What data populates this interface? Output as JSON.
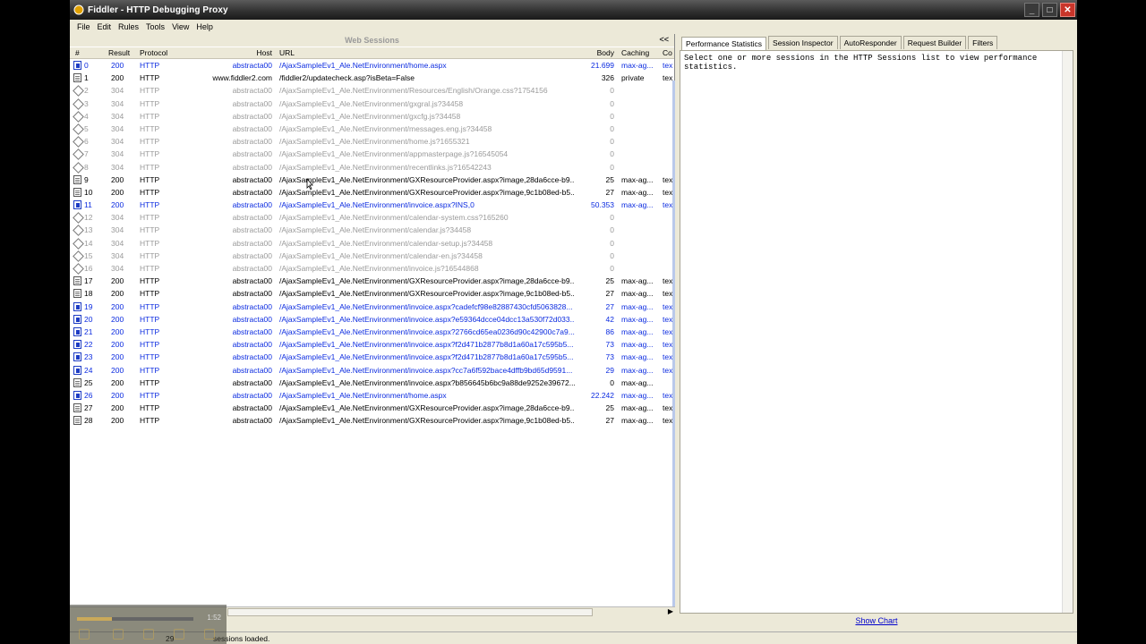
{
  "window": {
    "title": "Fiddler - HTTP Debugging Proxy"
  },
  "menu": [
    "File",
    "Edit",
    "Rules",
    "Tools",
    "View",
    "Help"
  ],
  "sessions_panel": {
    "title": "Web Sessions",
    "collapse_label": "<<",
    "columns": {
      "num": "#",
      "result": "Result",
      "protocol": "Protocol",
      "host": "Host",
      "url": "URL",
      "body": "Body",
      "caching": "Caching",
      "content_type": "Co"
    },
    "rows": [
      {
        "num": "0",
        "result": "200",
        "protocol": "HTTP",
        "host": "abstracta00",
        "url": "/AjaxSampleEv1_Ale.NetEnvironment/home.aspx",
        "body": "21.699",
        "caching": "max-ag...",
        "ct": "tex",
        "style": "blue",
        "icon": "blue"
      },
      {
        "num": "1",
        "result": "200",
        "protocol": "HTTP",
        "host": "www.fiddler2.com",
        "url": "/fiddler2/updatecheck.asp?isBeta=False",
        "body": "326",
        "caching": "private",
        "ct": "tex",
        "style": "black",
        "icon": "doc"
      },
      {
        "num": "2",
        "result": "304",
        "protocol": "HTTP",
        "host": "abstracta00",
        "url": "/AjaxSampleEv1_Ale.NetEnvironment/Resources/English/Orange.css?1754156",
        "body": "0",
        "caching": "",
        "ct": "",
        "style": "gray",
        "icon": "diamond"
      },
      {
        "num": "3",
        "result": "304",
        "protocol": "HTTP",
        "host": "abstracta00",
        "url": "/AjaxSampleEv1_Ale.NetEnvironment/gxgral.js?34458",
        "body": "0",
        "caching": "",
        "ct": "",
        "style": "gray",
        "icon": "diamond"
      },
      {
        "num": "4",
        "result": "304",
        "protocol": "HTTP",
        "host": "abstracta00",
        "url": "/AjaxSampleEv1_Ale.NetEnvironment/gxcfg.js?34458",
        "body": "0",
        "caching": "",
        "ct": "",
        "style": "gray",
        "icon": "diamond"
      },
      {
        "num": "5",
        "result": "304",
        "protocol": "HTTP",
        "host": "abstracta00",
        "url": "/AjaxSampleEv1_Ale.NetEnvironment/messages.eng.js?34458",
        "body": "0",
        "caching": "",
        "ct": "",
        "style": "gray",
        "icon": "diamond"
      },
      {
        "num": "6",
        "result": "304",
        "protocol": "HTTP",
        "host": "abstracta00",
        "url": "/AjaxSampleEv1_Ale.NetEnvironment/home.js?1655321",
        "body": "0",
        "caching": "",
        "ct": "",
        "style": "gray",
        "icon": "diamond"
      },
      {
        "num": "7",
        "result": "304",
        "protocol": "HTTP",
        "host": "abstracta00",
        "url": "/AjaxSampleEv1_Ale.NetEnvironment/appmasterpage.js?16545054",
        "body": "0",
        "caching": "",
        "ct": "",
        "style": "gray",
        "icon": "diamond"
      },
      {
        "num": "8",
        "result": "304",
        "protocol": "HTTP",
        "host": "abstracta00",
        "url": "/AjaxSampleEv1_Ale.NetEnvironment/recentlinks.js?16542243",
        "body": "0",
        "caching": "",
        "ct": "",
        "style": "gray",
        "icon": "diamond"
      },
      {
        "num": "9",
        "result": "200",
        "protocol": "HTTP",
        "host": "abstracta00",
        "url": "/AjaxSampleEv1_Ale.NetEnvironment/GXResourceProvider.aspx?image,28da6cce-b9...",
        "body": "25",
        "caching": "max-ag...",
        "ct": "tex",
        "style": "black",
        "icon": "doc"
      },
      {
        "num": "10",
        "result": "200",
        "protocol": "HTTP",
        "host": "abstracta00",
        "url": "/AjaxSampleEv1_Ale.NetEnvironment/GXResourceProvider.aspx?image,9c1b08ed-b5...",
        "body": "27",
        "caching": "max-ag...",
        "ct": "tex",
        "style": "black",
        "icon": "doc"
      },
      {
        "num": "11",
        "result": "200",
        "protocol": "HTTP",
        "host": "abstracta00",
        "url": "/AjaxSampleEv1_Ale.NetEnvironment/invoice.aspx?INS,0",
        "body": "50.353",
        "caching": "max-ag...",
        "ct": "tex",
        "style": "blue",
        "icon": "blue"
      },
      {
        "num": "12",
        "result": "304",
        "protocol": "HTTP",
        "host": "abstracta00",
        "url": "/AjaxSampleEv1_Ale.NetEnvironment/calendar-system.css?165260",
        "body": "0",
        "caching": "",
        "ct": "",
        "style": "gray",
        "icon": "diamond"
      },
      {
        "num": "13",
        "result": "304",
        "protocol": "HTTP",
        "host": "abstracta00",
        "url": "/AjaxSampleEv1_Ale.NetEnvironment/calendar.js?34458",
        "body": "0",
        "caching": "",
        "ct": "",
        "style": "gray",
        "icon": "diamond"
      },
      {
        "num": "14",
        "result": "304",
        "protocol": "HTTP",
        "host": "abstracta00",
        "url": "/AjaxSampleEv1_Ale.NetEnvironment/calendar-setup.js?34458",
        "body": "0",
        "caching": "",
        "ct": "",
        "style": "gray",
        "icon": "diamond"
      },
      {
        "num": "15",
        "result": "304",
        "protocol": "HTTP",
        "host": "abstracta00",
        "url": "/AjaxSampleEv1_Ale.NetEnvironment/calendar-en.js?34458",
        "body": "0",
        "caching": "",
        "ct": "",
        "style": "gray",
        "icon": "diamond"
      },
      {
        "num": "16",
        "result": "304",
        "protocol": "HTTP",
        "host": "abstracta00",
        "url": "/AjaxSampleEv1_Ale.NetEnvironment/invoice.js?16544868",
        "body": "0",
        "caching": "",
        "ct": "",
        "style": "gray",
        "icon": "diamond"
      },
      {
        "num": "17",
        "result": "200",
        "protocol": "HTTP",
        "host": "abstracta00",
        "url": "/AjaxSampleEv1_Ale.NetEnvironment/GXResourceProvider.aspx?image,28da6cce-b9...",
        "body": "25",
        "caching": "max-ag...",
        "ct": "tex",
        "style": "black",
        "icon": "doc"
      },
      {
        "num": "18",
        "result": "200",
        "protocol": "HTTP",
        "host": "abstracta00",
        "url": "/AjaxSampleEv1_Ale.NetEnvironment/GXResourceProvider.aspx?image,9c1b08ed-b5...",
        "body": "27",
        "caching": "max-ag...",
        "ct": "tex",
        "style": "black",
        "icon": "doc"
      },
      {
        "num": "19",
        "result": "200",
        "protocol": "HTTP",
        "host": "abstracta00",
        "url": "/AjaxSampleEv1_Ale.NetEnvironment/invoice.aspx?cadefcf98e82887430cfd5063828...",
        "body": "27",
        "caching": "max-ag...",
        "ct": "tex",
        "style": "blue",
        "icon": "blue"
      },
      {
        "num": "20",
        "result": "200",
        "protocol": "HTTP",
        "host": "abstracta00",
        "url": "/AjaxSampleEv1_Ale.NetEnvironment/invoice.aspx?e59364dcce04dcc13a530f72d033...",
        "body": "42",
        "caching": "max-ag...",
        "ct": "tex",
        "style": "blue",
        "icon": "blue"
      },
      {
        "num": "21",
        "result": "200",
        "protocol": "HTTP",
        "host": "abstracta00",
        "url": "/AjaxSampleEv1_Ale.NetEnvironment/invoice.aspx?2766cd65ea0236d90c42900c7a9...",
        "body": "86",
        "caching": "max-ag...",
        "ct": "tex",
        "style": "blue",
        "icon": "blue"
      },
      {
        "num": "22",
        "result": "200",
        "protocol": "HTTP",
        "host": "abstracta00",
        "url": "/AjaxSampleEv1_Ale.NetEnvironment/invoice.aspx?f2d471b2877b8d1a60a17c595b5...",
        "body": "73",
        "caching": "max-ag...",
        "ct": "tex",
        "style": "blue",
        "icon": "blue"
      },
      {
        "num": "23",
        "result": "200",
        "protocol": "HTTP",
        "host": "abstracta00",
        "url": "/AjaxSampleEv1_Ale.NetEnvironment/invoice.aspx?f2d471b2877b8d1a60a17c595b5...",
        "body": "73",
        "caching": "max-ag...",
        "ct": "tex",
        "style": "blue",
        "icon": "blue"
      },
      {
        "num": "24",
        "result": "200",
        "protocol": "HTTP",
        "host": "abstracta00",
        "url": "/AjaxSampleEv1_Ale.NetEnvironment/invoice.aspx?cc7a6f592bace4dffb9bd65d9591...",
        "body": "29",
        "caching": "max-ag...",
        "ct": "tex",
        "style": "blue",
        "icon": "blue"
      },
      {
        "num": "25",
        "result": "200",
        "protocol": "HTTP",
        "host": "abstracta00",
        "url": "/AjaxSampleEv1_Ale.NetEnvironment/invoice.aspx?b856645b6bc9a88de9252e39672...",
        "body": "0",
        "caching": "max-ag...",
        "ct": "",
        "style": "black",
        "icon": "doc"
      },
      {
        "num": "26",
        "result": "200",
        "protocol": "HTTP",
        "host": "abstracta00",
        "url": "/AjaxSampleEv1_Ale.NetEnvironment/home.aspx",
        "body": "22.242",
        "caching": "max-ag...",
        "ct": "tex",
        "style": "blue",
        "icon": "blue"
      },
      {
        "num": "27",
        "result": "200",
        "protocol": "HTTP",
        "host": "abstracta00",
        "url": "/AjaxSampleEv1_Ale.NetEnvironment/GXResourceProvider.aspx?image,28da6cce-b9...",
        "body": "25",
        "caching": "max-ag...",
        "ct": "tex",
        "style": "black",
        "icon": "doc"
      },
      {
        "num": "28",
        "result": "200",
        "protocol": "HTTP",
        "host": "abstracta00",
        "url": "/AjaxSampleEv1_Ale.NetEnvironment/GXResourceProvider.aspx?image,9c1b08ed-b5...",
        "body": "27",
        "caching": "max-ag...",
        "ct": "tex",
        "style": "black",
        "icon": "doc"
      }
    ]
  },
  "right_panel": {
    "tabs": [
      "Performance Statistics",
      "Session Inspector",
      "AutoResponder",
      "Request Builder",
      "Filters"
    ],
    "active_tab": 0,
    "message": "Select one or more sessions in the HTTP Sessions list to view performance statistics.",
    "show_chart_label": "Show Chart"
  },
  "status_bar": {
    "count": "29",
    "message": "sessions loaded."
  },
  "media_overlay": {
    "time": "1:52",
    "progress": 0.3
  },
  "colors": {
    "success_blue": "#0b2be0",
    "cached_gray": "#9a9a9a",
    "window_bg": "#ece9d8"
  }
}
